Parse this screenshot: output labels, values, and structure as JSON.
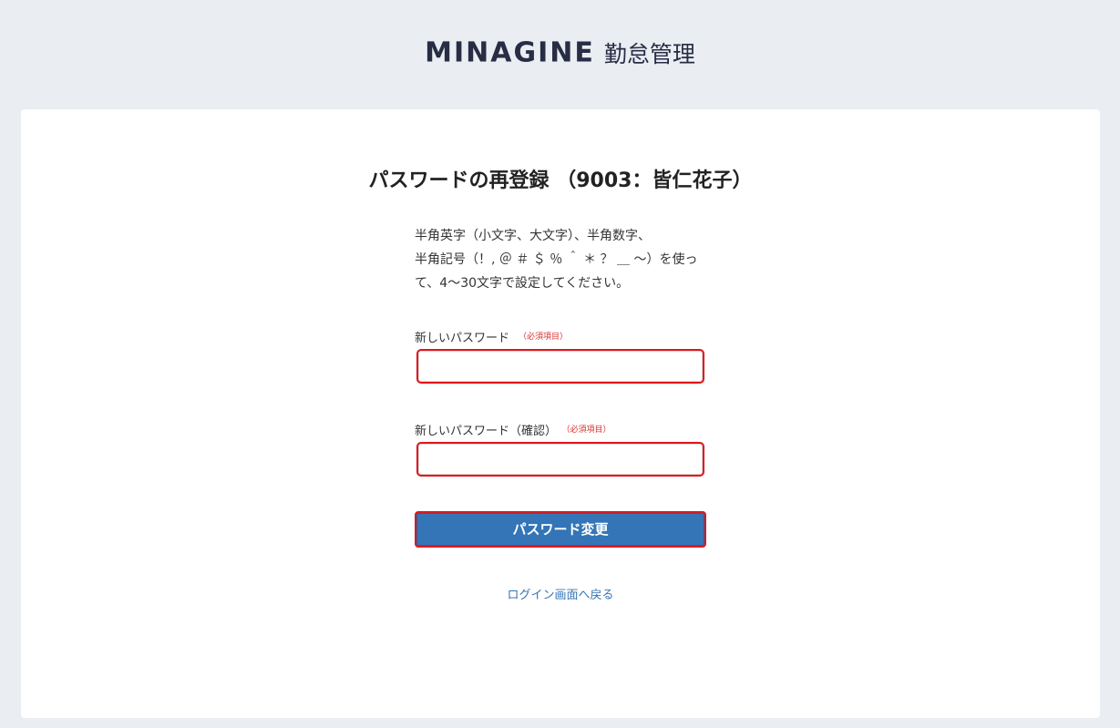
{
  "header": {
    "brand": "MINAGINE",
    "product": "勤怠管理"
  },
  "form": {
    "title": "パスワードの再登録 （9003：皆仁花子）",
    "instructions": [
      "半角英字（小文字、大文字）、半角数字、",
      "半角記号（！, ＠ ＃ ＄ ％ ＾ ＊ ？ ＿ ～）を使っ",
      "て、4〜30文字で設定してください。"
    ],
    "new_password": {
      "label": "新しいパスワード",
      "required": "（必須項目）",
      "value": ""
    },
    "confirm_password": {
      "label": "新しいパスワード（確認）",
      "required": "（必須項目）",
      "value": ""
    },
    "submit_label": "パスワード変更",
    "back_link": "ログイン画面へ戻る"
  },
  "colors": {
    "background": "#eaedf2",
    "brand": "#272d44",
    "primary_button": "#3375b7",
    "error_border": "#e3141b",
    "required": "#d9302c",
    "link": "#3474b4"
  }
}
